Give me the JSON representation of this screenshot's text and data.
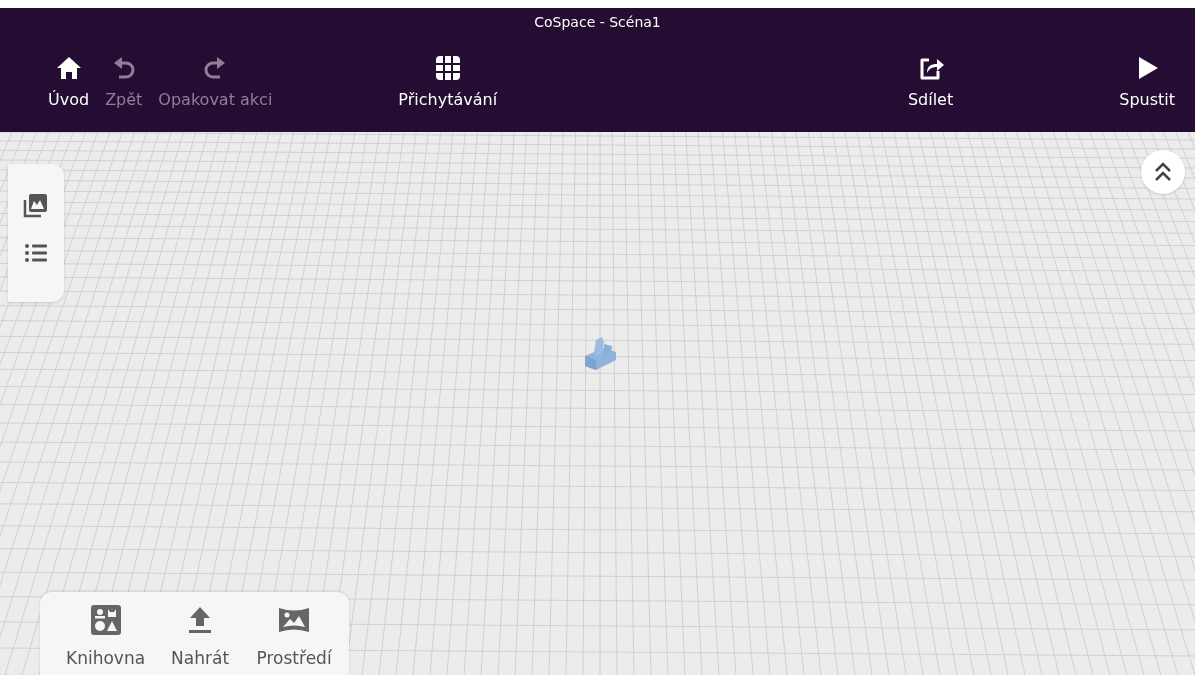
{
  "window": {
    "title": "CoSpace - Scéna1"
  },
  "toolbar": [
    {
      "kind": "home",
      "label": "Úvod",
      "disabled": false
    },
    {
      "kind": "undo",
      "label": "Zpět",
      "disabled": true
    },
    {
      "kind": "redo",
      "label": "Opakovat akci",
      "disabled": true
    },
    {
      "kind": "snap",
      "label": "Přichytávání",
      "disabled": false
    },
    {
      "kind": "share",
      "label": "Sdílet",
      "disabled": false
    },
    {
      "kind": "play",
      "label": "Spustit",
      "disabled": false
    }
  ],
  "bottom_bar": [
    {
      "kind": "library",
      "label": "Knihovna"
    },
    {
      "kind": "upload",
      "label": "Nahrát"
    },
    {
      "kind": "environment",
      "label": "Prostředí"
    }
  ]
}
